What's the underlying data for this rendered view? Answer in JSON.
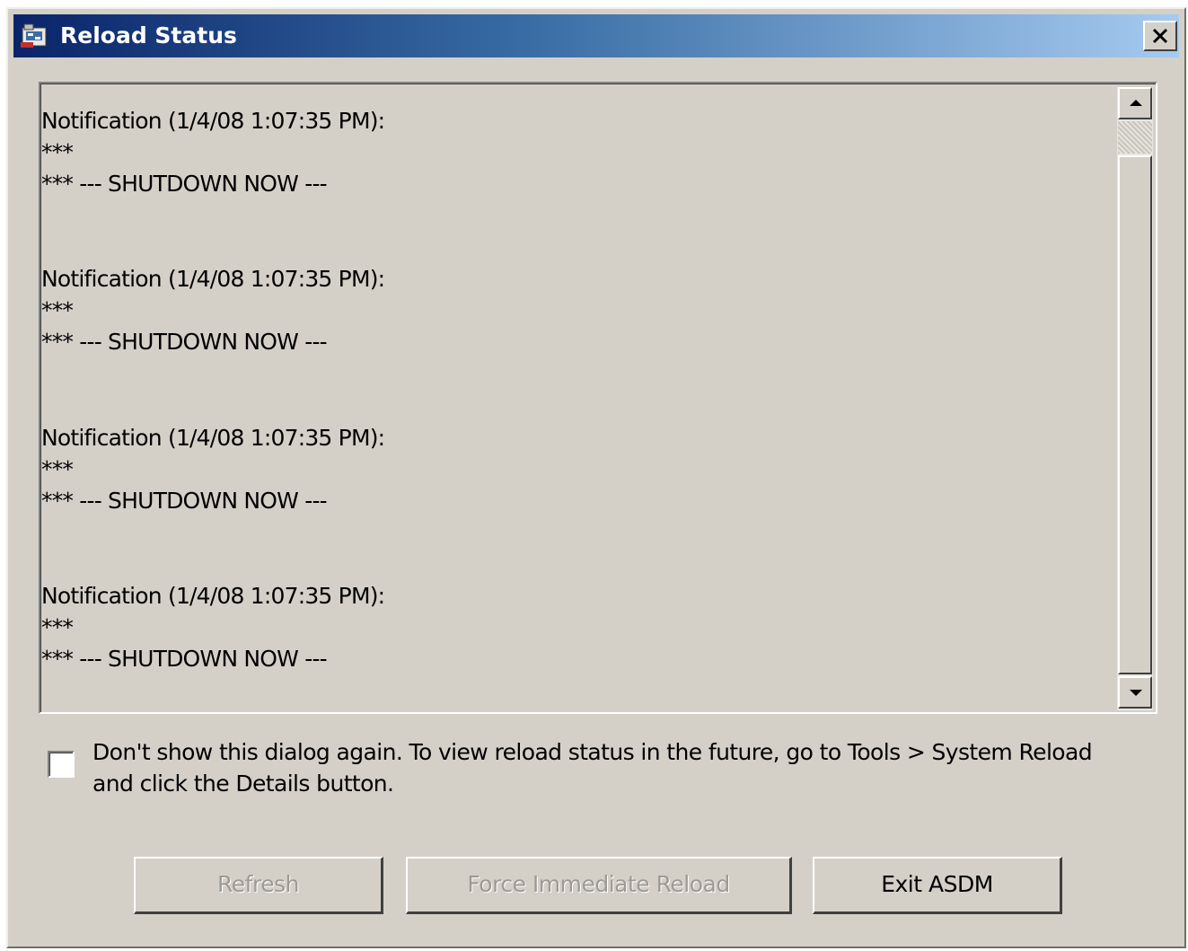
{
  "window": {
    "title": "Reload Status",
    "close_label": "✕"
  },
  "log": {
    "entries": [
      {
        "line1": "Notification (1/4/08 1:07:35 PM):",
        "line2": "***",
        "line3": "*** --- SHUTDOWN NOW ---"
      },
      {
        "line1": "Notification (1/4/08 1:07:35 PM):",
        "line2": "***",
        "line3": "*** --- SHUTDOWN NOW ---"
      },
      {
        "line1": "Notification (1/4/08 1:07:35 PM):",
        "line2": "***",
        "line3": "*** --- SHUTDOWN NOW ---"
      },
      {
        "line1": "Notification (1/4/08 1:07:35 PM):",
        "line2": "***",
        "line3": "*** --- SHUTDOWN NOW ---"
      }
    ]
  },
  "dont_show": {
    "label": "Don't show this dialog again. To view reload status in the future, go to Tools > System Reload and click the Details button.",
    "checked": false
  },
  "buttons": {
    "refresh": "Refresh",
    "force_reload": "Force Immediate Reload",
    "exit": "Exit ASDM"
  },
  "colors": {
    "titlebar_start": "#0a246a",
    "titlebar_end": "#a6caf0",
    "dialog_bg": "#d4d0c8"
  },
  "icons": {
    "title": "asdm-app-icon",
    "close": "close-icon",
    "scroll_up": "arrow-up-icon",
    "scroll_down": "arrow-down-icon"
  }
}
